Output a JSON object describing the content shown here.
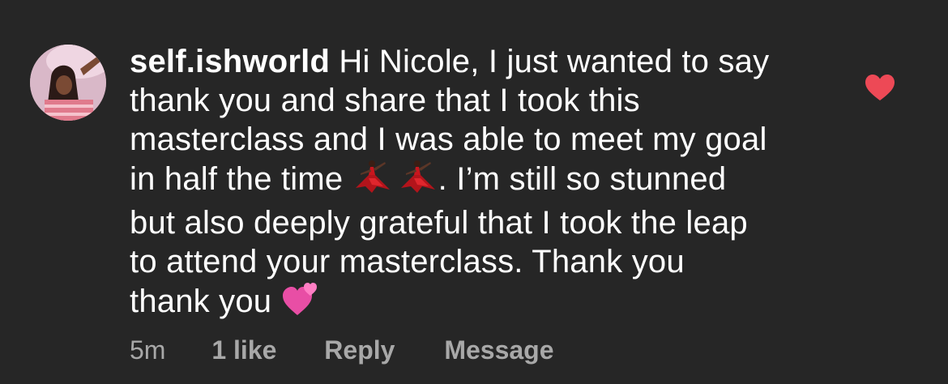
{
  "comment": {
    "username": "self.ishworld",
    "lines": [
      " Hi Nicole, I just wanted to say",
      "thank you and share that I took this",
      "masterclass and I was able to meet my goal",
      "in half the time ",
      ". I’m still so stunned",
      "but also deeply grateful that I took the leap",
      "to attend your masterclass. Thank you",
      "thank you "
    ],
    "emojis": [
      "dancer-emoji",
      "dancer-emoji",
      "two-hearts-emoji"
    ]
  },
  "meta": {
    "time": "5m",
    "likes": "1 like",
    "reply": "Reply",
    "message": "Message"
  },
  "icons": {
    "like": "heart-icon",
    "avatar": "avatar-image"
  },
  "colors": {
    "background": "#262626",
    "text": "#ffffff",
    "meta": "#a8a8a8",
    "heart": "#ed4956"
  }
}
